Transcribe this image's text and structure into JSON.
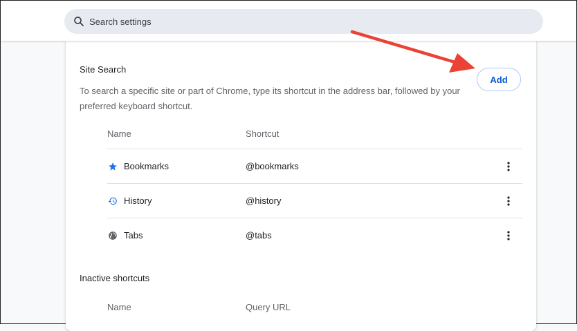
{
  "search": {
    "placeholder": "Search settings"
  },
  "site_search": {
    "title": "Site Search",
    "description": "To search a specific site or part of Chrome, type its shortcut in the address bar, followed by your preferred keyboard shortcut.",
    "add_label": "Add",
    "columns": {
      "name": "Name",
      "shortcut": "Shortcut"
    },
    "rows": [
      {
        "name": "Bookmarks",
        "shortcut": "@bookmarks",
        "icon": "star-icon"
      },
      {
        "name": "History",
        "shortcut": "@history",
        "icon": "history-icon"
      },
      {
        "name": "Tabs",
        "shortcut": "@tabs",
        "icon": "globe-icon"
      }
    ]
  },
  "inactive": {
    "title": "Inactive shortcuts",
    "columns": {
      "name": "Name",
      "query_url": "Query URL"
    }
  },
  "colors": {
    "accent": "#0b57d0",
    "star": "#1a73e8",
    "annotation_arrow": "#ea4335"
  }
}
